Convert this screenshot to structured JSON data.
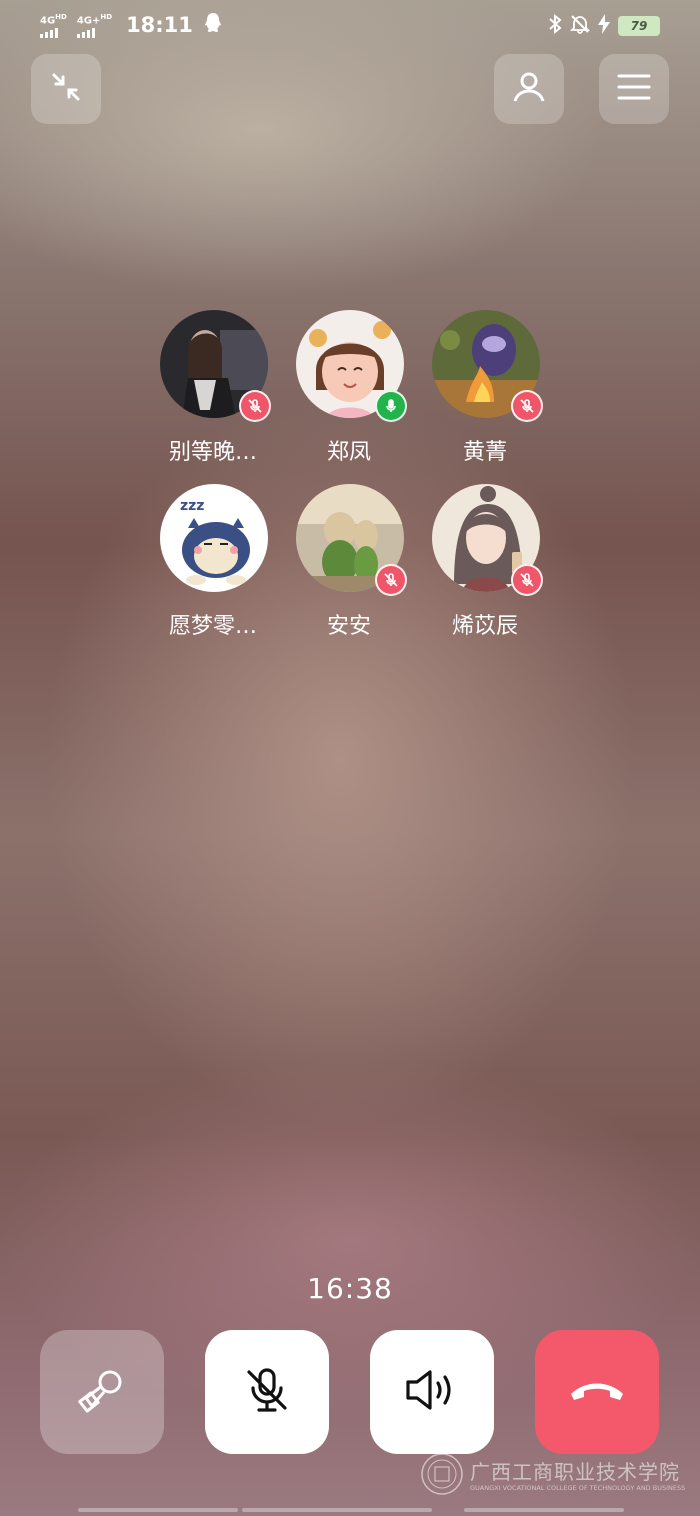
{
  "status_bar": {
    "sim1_label": "4G",
    "sim1_suffix": "HD",
    "sim2_label": "4G+",
    "sim2_suffix": "HD",
    "time": "18:11",
    "battery": "79",
    "icons": [
      "qq-icon",
      "bluetooth-icon",
      "bell-off-icon",
      "charging-bolt-icon"
    ]
  },
  "top_bar": {
    "left_icon": "minimize-arrows-icon",
    "right_icons": [
      "add-person-icon",
      "menu-icon"
    ]
  },
  "participants": [
    {
      "name": "别等晚…",
      "mic": "muted",
      "avatar_colors": [
        "#2a2a2e",
        "#c9a999"
      ]
    },
    {
      "name": "郑凤",
      "mic": "on",
      "avatar_colors": [
        "#f4eeea",
        "#f7c9b7"
      ]
    },
    {
      "name": "黄菁",
      "mic": "muted",
      "avatar_colors": [
        "#5f6a3a",
        "#f09a3a"
      ]
    },
    {
      "name": "愿梦零…",
      "mic": "none",
      "avatar_colors": [
        "#ffffff",
        "#3a4f84"
      ]
    },
    {
      "name": "安安",
      "mic": "muted",
      "avatar_colors": [
        "#c8bca6",
        "#5d8a3a"
      ]
    },
    {
      "name": "烯苡辰",
      "mic": "muted",
      "avatar_colors": [
        "#efe6dc",
        "#6a5a5a"
      ]
    }
  ],
  "call": {
    "duration": "16:38",
    "controls": [
      "camera-off-icon",
      "mic-off-icon",
      "speaker-icon",
      "hang-up-icon"
    ],
    "hangup_color": "#f3586b"
  },
  "watermark": {
    "title": "广西工商职业技术学院",
    "subtitle": "GUANGXI VOCATIONAL COLLEGE OF TECHNOLOGY AND BUSINESS"
  }
}
